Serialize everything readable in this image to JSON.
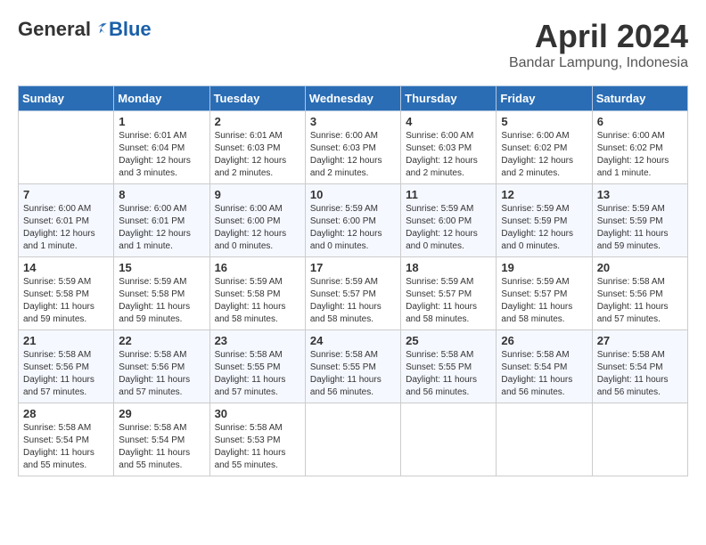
{
  "header": {
    "logo_general": "General",
    "logo_blue": "Blue",
    "month_title": "April 2024",
    "subtitle": "Bandar Lampung, Indonesia"
  },
  "days_of_week": [
    "Sunday",
    "Monday",
    "Tuesday",
    "Wednesday",
    "Thursday",
    "Friday",
    "Saturday"
  ],
  "weeks": [
    [
      {
        "num": "",
        "info": ""
      },
      {
        "num": "1",
        "info": "Sunrise: 6:01 AM\nSunset: 6:04 PM\nDaylight: 12 hours\nand 3 minutes."
      },
      {
        "num": "2",
        "info": "Sunrise: 6:01 AM\nSunset: 6:03 PM\nDaylight: 12 hours\nand 2 minutes."
      },
      {
        "num": "3",
        "info": "Sunrise: 6:00 AM\nSunset: 6:03 PM\nDaylight: 12 hours\nand 2 minutes."
      },
      {
        "num": "4",
        "info": "Sunrise: 6:00 AM\nSunset: 6:03 PM\nDaylight: 12 hours\nand 2 minutes."
      },
      {
        "num": "5",
        "info": "Sunrise: 6:00 AM\nSunset: 6:02 PM\nDaylight: 12 hours\nand 2 minutes."
      },
      {
        "num": "6",
        "info": "Sunrise: 6:00 AM\nSunset: 6:02 PM\nDaylight: 12 hours\nand 1 minute."
      }
    ],
    [
      {
        "num": "7",
        "info": "Sunrise: 6:00 AM\nSunset: 6:01 PM\nDaylight: 12 hours\nand 1 minute."
      },
      {
        "num": "8",
        "info": "Sunrise: 6:00 AM\nSunset: 6:01 PM\nDaylight: 12 hours\nand 1 minute."
      },
      {
        "num": "9",
        "info": "Sunrise: 6:00 AM\nSunset: 6:00 PM\nDaylight: 12 hours\nand 0 minutes."
      },
      {
        "num": "10",
        "info": "Sunrise: 5:59 AM\nSunset: 6:00 PM\nDaylight: 12 hours\nand 0 minutes."
      },
      {
        "num": "11",
        "info": "Sunrise: 5:59 AM\nSunset: 6:00 PM\nDaylight: 12 hours\nand 0 minutes."
      },
      {
        "num": "12",
        "info": "Sunrise: 5:59 AM\nSunset: 5:59 PM\nDaylight: 12 hours\nand 0 minutes."
      },
      {
        "num": "13",
        "info": "Sunrise: 5:59 AM\nSunset: 5:59 PM\nDaylight: 11 hours\nand 59 minutes."
      }
    ],
    [
      {
        "num": "14",
        "info": "Sunrise: 5:59 AM\nSunset: 5:58 PM\nDaylight: 11 hours\nand 59 minutes."
      },
      {
        "num": "15",
        "info": "Sunrise: 5:59 AM\nSunset: 5:58 PM\nDaylight: 11 hours\nand 59 minutes."
      },
      {
        "num": "16",
        "info": "Sunrise: 5:59 AM\nSunset: 5:58 PM\nDaylight: 11 hours\nand 58 minutes."
      },
      {
        "num": "17",
        "info": "Sunrise: 5:59 AM\nSunset: 5:57 PM\nDaylight: 11 hours\nand 58 minutes."
      },
      {
        "num": "18",
        "info": "Sunrise: 5:59 AM\nSunset: 5:57 PM\nDaylight: 11 hours\nand 58 minutes."
      },
      {
        "num": "19",
        "info": "Sunrise: 5:59 AM\nSunset: 5:57 PM\nDaylight: 11 hours\nand 58 minutes."
      },
      {
        "num": "20",
        "info": "Sunrise: 5:58 AM\nSunset: 5:56 PM\nDaylight: 11 hours\nand 57 minutes."
      }
    ],
    [
      {
        "num": "21",
        "info": "Sunrise: 5:58 AM\nSunset: 5:56 PM\nDaylight: 11 hours\nand 57 minutes."
      },
      {
        "num": "22",
        "info": "Sunrise: 5:58 AM\nSunset: 5:56 PM\nDaylight: 11 hours\nand 57 minutes."
      },
      {
        "num": "23",
        "info": "Sunrise: 5:58 AM\nSunset: 5:55 PM\nDaylight: 11 hours\nand 57 minutes."
      },
      {
        "num": "24",
        "info": "Sunrise: 5:58 AM\nSunset: 5:55 PM\nDaylight: 11 hours\nand 56 minutes."
      },
      {
        "num": "25",
        "info": "Sunrise: 5:58 AM\nSunset: 5:55 PM\nDaylight: 11 hours\nand 56 minutes."
      },
      {
        "num": "26",
        "info": "Sunrise: 5:58 AM\nSunset: 5:54 PM\nDaylight: 11 hours\nand 56 minutes."
      },
      {
        "num": "27",
        "info": "Sunrise: 5:58 AM\nSunset: 5:54 PM\nDaylight: 11 hours\nand 56 minutes."
      }
    ],
    [
      {
        "num": "28",
        "info": "Sunrise: 5:58 AM\nSunset: 5:54 PM\nDaylight: 11 hours\nand 55 minutes."
      },
      {
        "num": "29",
        "info": "Sunrise: 5:58 AM\nSunset: 5:54 PM\nDaylight: 11 hours\nand 55 minutes."
      },
      {
        "num": "30",
        "info": "Sunrise: 5:58 AM\nSunset: 5:53 PM\nDaylight: 11 hours\nand 55 minutes."
      },
      {
        "num": "",
        "info": ""
      },
      {
        "num": "",
        "info": ""
      },
      {
        "num": "",
        "info": ""
      },
      {
        "num": "",
        "info": ""
      }
    ]
  ]
}
